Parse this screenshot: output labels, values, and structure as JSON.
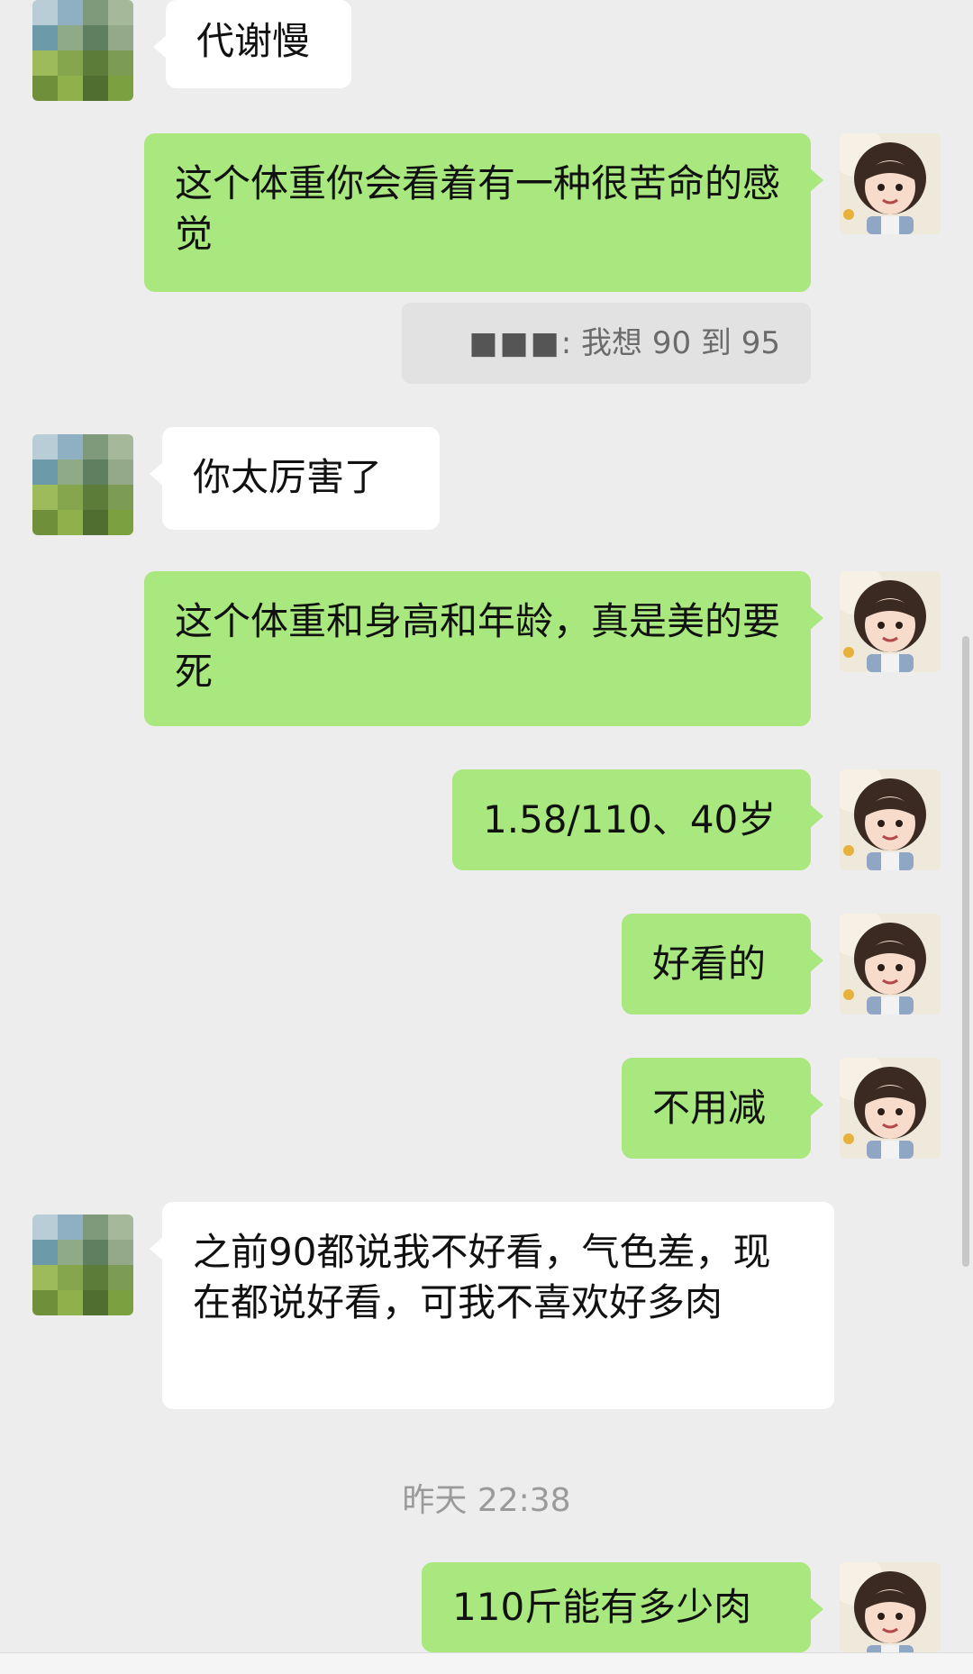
{
  "messages": {
    "m1": {
      "text": "代谢慢"
    },
    "m2": {
      "text": "这个体重你会看着有一种很苦命的感觉"
    },
    "m3": {
      "sender": "■■■",
      "text": "我想 90 到 95"
    },
    "m4": {
      "text": "你太厉害了"
    },
    "m5": {
      "text": "这个体重和身高和年龄，真是美的要死"
    },
    "m6": {
      "text": "1.58/110、40岁"
    },
    "m7": {
      "text": "好看的"
    },
    "m8": {
      "text": "不用减"
    },
    "m9": {
      "text": "之前90都说我不好看，气色差，现在都说好看，可我不喜欢好多肉"
    },
    "m10": {
      "text": "110斤能有多少肉"
    }
  },
  "timestamp": "昨天 22:38",
  "colors": {
    "background": "#ededed",
    "sent_bubble": "#a9e87e",
    "received_bubble": "#ffffff",
    "quote_bubble": "#e2e2e2"
  },
  "icons": {
    "other_avatar": "pixelated-landscape-avatar",
    "my_avatar": "cartoon-girl-avatar"
  }
}
